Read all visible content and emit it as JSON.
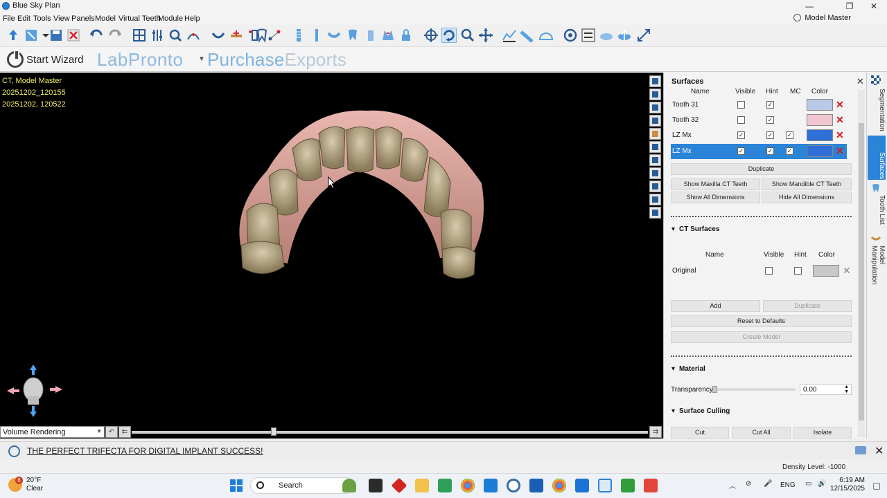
{
  "window": {
    "title": "Blue Sky Plan",
    "minimize": "—",
    "maximize": "❐",
    "close": "✕"
  },
  "menu": [
    "File",
    "Edit",
    "Tools",
    "View",
    "Panels",
    "Model",
    "Virtual Teeth",
    "Module",
    "Help"
  ],
  "model_master": "Model Master",
  "wizard": {
    "start": "Start Wizard",
    "labpronto": "LabPronto",
    "purchase": "Purchase",
    "exports": "Exports"
  },
  "viewport": {
    "info": [
      "CT, Model Master",
      "20251202_120155",
      "20251202, 120522"
    ],
    "render_mode": "Volume Rendering"
  },
  "panel": {
    "title": "Surfaces",
    "columns": {
      "name": "Name",
      "visible": "Visible",
      "hint": "Hint",
      "mc": "MC",
      "color": "Color"
    },
    "surfaces": [
      {
        "name": "Tooth 31",
        "visible": false,
        "hint": true,
        "mc": null,
        "color": "#b9c9e6",
        "selected": false
      },
      {
        "name": "Tooth 32",
        "visible": false,
        "hint": true,
        "mc": null,
        "color": "#f2c6d0",
        "selected": false
      },
      {
        "name": "LZ Mx",
        "visible": true,
        "hint": true,
        "mc": true,
        "color": "#2f6fd6",
        "selected": false
      },
      {
        "name": "LZ Mx",
        "visible": true,
        "hint": true,
        "mc": true,
        "color": "#2f6fd6",
        "selected": true
      }
    ],
    "buttons": {
      "duplicate": "Duplicate",
      "show_max": "Show Maxilla CT Teeth",
      "show_mand": "Show Mandible CT Teeth",
      "show_dims": "Show All Dimensions",
      "hide_dims": "Hide All Dimensions"
    },
    "ct_surfaces": {
      "title": "CT Surfaces",
      "columns": {
        "name": "Name",
        "visible": "Visible",
        "hint": "Hint",
        "color": "Color"
      },
      "rows": [
        {
          "name": "Original",
          "visible": false,
          "hint": false,
          "color": "#c8c8c8"
        }
      ],
      "add": "Add",
      "duplicate": "Duplicate",
      "reset": "Reset to Defaults",
      "create_model": "Create Model"
    },
    "material": {
      "title": "Material",
      "transparency_label": "Transparency",
      "transparency_value": "0.00"
    },
    "culling": {
      "title": "Surface Culling",
      "cut": "Cut",
      "cut_all": "Cut All",
      "isolate": "Isolate"
    }
  },
  "side_tabs": [
    "Segmentation",
    "Surfaces",
    "Tooth List",
    "Model Manipulation"
  ],
  "promo": "THE PERFECT TRIFECTA FOR DIGITAL IMPLANT SUCCESS!",
  "status": {
    "density": "Density Level: -1000"
  },
  "taskbar": {
    "weather_temp": "20°F",
    "weather_desc": "Clear",
    "weather_badge": "6",
    "search": "Search",
    "lang": "ENG",
    "time": "6:19 AM",
    "date": "12/15/2025"
  }
}
